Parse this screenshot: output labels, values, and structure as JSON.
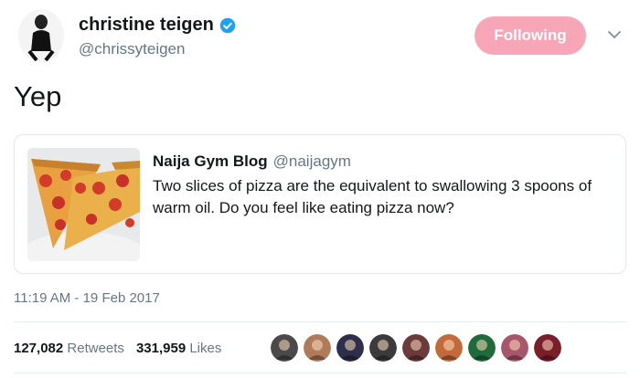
{
  "user": {
    "display_name": "christine teigen",
    "handle": "@chrissyteigen",
    "verified_icon": "verified-badge-icon"
  },
  "follow_button": {
    "label": "Following",
    "color": "#f7a6b7"
  },
  "tweet": {
    "text": "Yep"
  },
  "quoted": {
    "author": "Naija Gym Blog",
    "handle": "@naijagym",
    "text": "Two slices of pizza are the equivalent to swallowing 3 spoons of warm oil. Do you feel like eating pizza now?",
    "image_icon": "pizza-slices-image"
  },
  "timestamp": "11:19 AM - 19 Feb 2017",
  "stats": {
    "retweets_count": "127,082",
    "retweets_label": "Retweets",
    "likes_count": "331,959",
    "likes_label": "Likes"
  },
  "likers": [
    {
      "color": "#4a4a4a"
    },
    {
      "color": "#b07b5b"
    },
    {
      "color": "#2e2f4a"
    },
    {
      "color": "#3b3b3b"
    },
    {
      "color": "#6b3a3a"
    },
    {
      "color": "#c26a3a"
    },
    {
      "color": "#1f6b3a"
    },
    {
      "color": "#a8566b"
    },
    {
      "color": "#7a1f2a"
    }
  ]
}
